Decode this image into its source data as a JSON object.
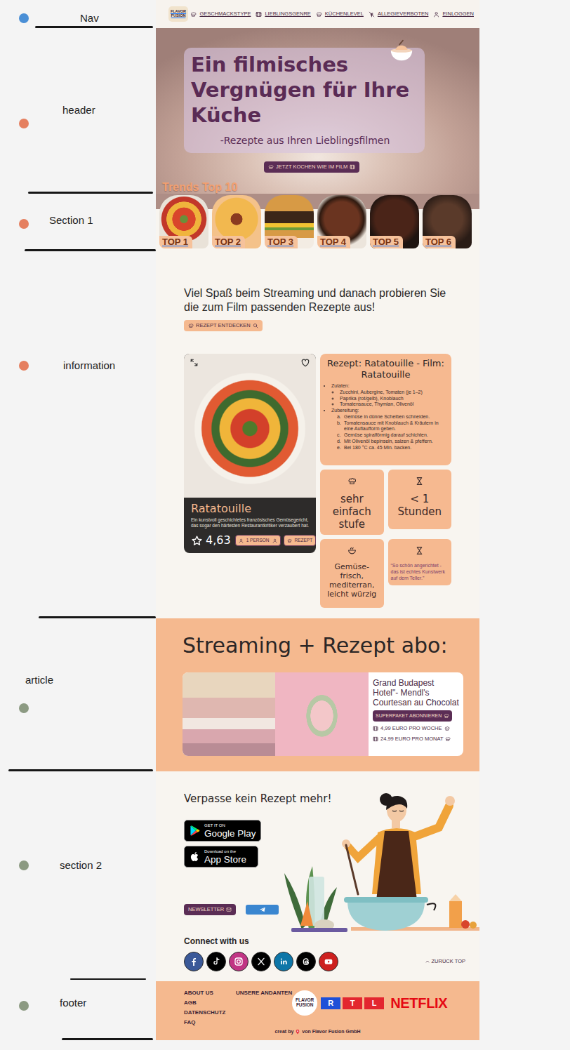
{
  "annotations": [
    {
      "label": "Nav",
      "color": "#4a8fd6"
    },
    {
      "label": "header",
      "color": "#e57f5f"
    },
    {
      "label": "Section 1",
      "color": "#e57f5f"
    },
    {
      "label": "information",
      "color": "#e57f5f"
    },
    {
      "label": "article",
      "color": "#8c9a82"
    },
    {
      "label": "section 2",
      "color": "#8c9a82"
    },
    {
      "label": "footer",
      "color": "#8c9a82"
    }
  ],
  "nav": {
    "logo": "FLAVOR FUSION",
    "links": [
      {
        "label": "GESCHMACKSTYPE"
      },
      {
        "label": "LIEBLINGSGENRE"
      },
      {
        "label": "KÜCHENLEVEL"
      },
      {
        "label": "ALLEGIEVERBOTEN"
      },
      {
        "label": "EINLOGGEN"
      }
    ]
  },
  "header": {
    "title": "Ein filmisches Vergnügen für Ihre Küche",
    "subtitle": "-Rezepte aus Ihren Lieblingsfilmen",
    "button": "JETZT KOCHEN WIE IM FILM",
    "trends_title": "Trends Top 10"
  },
  "trends": [
    {
      "label": "TOP 1"
    },
    {
      "label": "TOP 2"
    },
    {
      "label": "TOP 3"
    },
    {
      "label": "TOP 4"
    },
    {
      "label": "TOP 5"
    },
    {
      "label": "TOP 6"
    }
  ],
  "information": {
    "intro": "Viel Spaß beim Streaming und danach probieren Sie die zum Film passenden Rezepte aus!",
    "button": "REZEPT ENTDECKEN",
    "card": {
      "title": "Ratatouille",
      "description": "Ein kunstvoll geschichtetes französisches Gemüsegericht, das sogar den härtesten Restaurantkritiker verzaubert hat.",
      "rating": "4,63",
      "persons": "1 PERSON",
      "recipe_button": "REZEPT",
      "favorite": false
    },
    "recipe": {
      "title": "Rezept: Ratatouille - Film: Ratatouille",
      "sections": [
        {
          "heading": "Zutaten:",
          "kind": "bullets",
          "items": [
            {
              "text": "Zucchini, Aubergine, Tomaten (je 1–2)"
            },
            {
              "text": "Paprika (rot/gelb), Knoblauch"
            },
            {
              "text": "Tomatensauce, Thymian, Olivenöl"
            }
          ]
        },
        {
          "heading": "Zubereitung:",
          "kind": "steps",
          "items": [
            {
              "marker": "a.",
              "text": "Gemüse in dünne Scheiben schneiden."
            },
            {
              "marker": "b.",
              "text": "Tomatensauce mit Knoblauch & Kräutern in eine Auflaufform geben."
            },
            {
              "marker": "c.",
              "text": "Gemüse spiralförmig darauf schichten."
            },
            {
              "marker": "d.",
              "text": "Mit Olivenöl bepinseln, salzen & pfeffern."
            },
            {
              "marker": "e.",
              "text": "Bei 180 °C ca. 45 Min. backen."
            }
          ]
        }
      ]
    },
    "tiles": [
      {
        "kind": "level",
        "text": "sehr einfach stufe"
      },
      {
        "kind": "time",
        "text": "< 1 Stunden"
      },
      {
        "kind": "taste",
        "text": "Gemüse-frisch, mediterran, leicht würzig"
      },
      {
        "kind": "quote",
        "text": "“So schön angerichtet - das ist echtes Kunstwerk auf dem Teller.”"
      }
    ]
  },
  "article": {
    "title": "Streaming + Rezept abo:",
    "offer": {
      "title": "Grand Budapest Hotel\"- Mendl's Courtesan au Chocolat",
      "button": "SUPERPAKET ABONNIEREN",
      "prices": [
        {
          "text": "4,99 EURO PRO WOCHE"
        },
        {
          "text": "24,99 EURO PRO MONAT"
        }
      ]
    }
  },
  "app": {
    "title": "Verpasse kein Rezept mehr!",
    "stores": [
      {
        "small": "GET IT ON",
        "big": "Google Play"
      },
      {
        "small": "Download on the",
        "big": "App Store"
      }
    ],
    "newsletter": "NEWSLETTER",
    "connect": "Connect with us",
    "socials": [
      {
        "color": "#3b5998"
      },
      {
        "color": "#000000"
      },
      {
        "color": "#c13584"
      },
      {
        "color": "#000000"
      },
      {
        "color": "#0e76a8"
      },
      {
        "color": "#000000"
      },
      {
        "color": "#cd201f"
      }
    ],
    "back_to_top": "ZURÜCK TOP"
  },
  "footer": {
    "links": [
      "ABOUT US",
      "AGB",
      "DATENSCHUTZ",
      "FAQ"
    ],
    "links_right": [
      "UNSERE ANDANTEN"
    ],
    "logo": "FLAVOR FUSION",
    "rtl": [
      {
        "letter": "R",
        "color": "#1f4fd8"
      },
      {
        "letter": "T",
        "color": "#e3262f"
      },
      {
        "letter": "L",
        "color": "#e3262f"
      }
    ],
    "netflix": "NETFLIX",
    "credit_before": "creat by",
    "credit_after": "von Flavor Fusion GmbH"
  }
}
